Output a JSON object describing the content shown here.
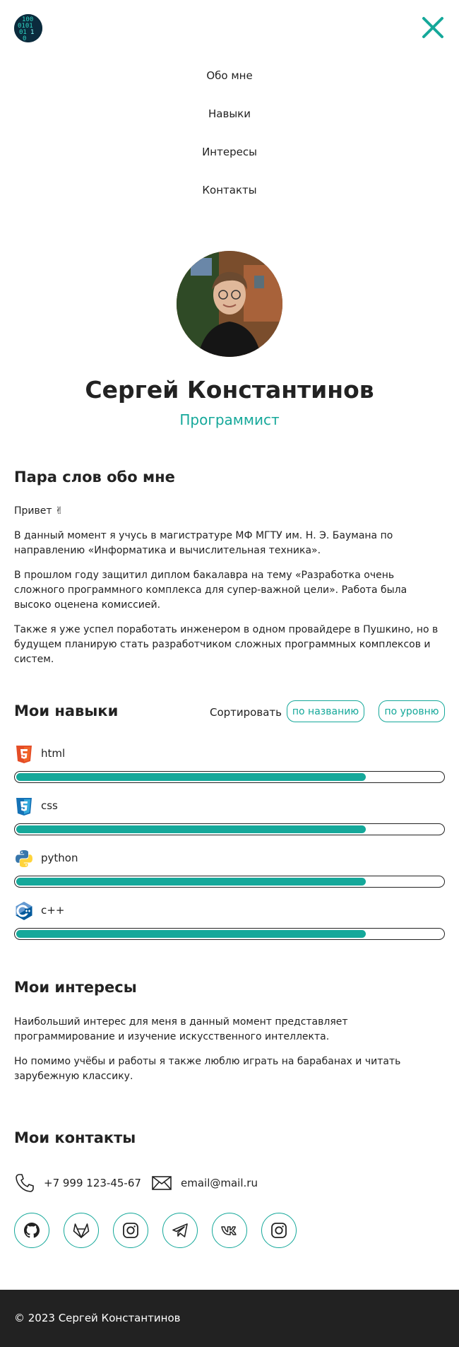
{
  "header": {
    "logo_icon": "binary-code-icon",
    "close_icon": "close-icon",
    "accent": "#15a89a"
  },
  "nav": {
    "items": [
      {
        "label": "Обо мне"
      },
      {
        "label": "Навыки"
      },
      {
        "label": "Интересы"
      },
      {
        "label": "Контакты"
      }
    ]
  },
  "profile": {
    "name": "Сергей Константинов",
    "role": "Программист"
  },
  "about": {
    "title": "Пара слов обо мне",
    "paragraphs": [
      "Привет ✌",
      "В данный момент я учусь в магистратуре МФ МГТУ им. Н. Э. Баумана по направлению «Информатика и вычислительная техника».",
      "В прошлом году защитил диплом бакалавра на тему «Разработка очень сложного программного комплекса для супер-важной цели». Работа была высоко оценена комиссией.",
      "Также я уже успел поработать инженером в одном провайдере в Пушкино, но в будущем планирую стать разработчиком сложных программных комплексов и систем."
    ]
  },
  "skills": {
    "title": "Мои навыки",
    "sort_label": "Сортировать",
    "sort_by_name": "по названию",
    "sort_by_level": "по уровню",
    "items": [
      {
        "label": "html",
        "icon": "html5-icon",
        "level": 0.82
      },
      {
        "label": "css",
        "icon": "css3-icon",
        "level": 0.82
      },
      {
        "label": "python",
        "icon": "python-icon",
        "level": 0.82
      },
      {
        "label": "c++",
        "icon": "cpp-icon",
        "level": 0.82
      }
    ]
  },
  "interests": {
    "title": "Мои интересы",
    "paragraphs": [
      "Наибольший интерес для меня в данный момент представляет программирование и изучение искусственного интеллекта.",
      "Но помимо учёбы и работы я также люблю играть на барабанах и читать зарубежную классику."
    ]
  },
  "contacts": {
    "title": "Мои контакты",
    "phone": "+7 999 123-45-67",
    "email": "email@mail.ru",
    "socials": [
      "github-icon",
      "gitlab-icon",
      "instagram-icon",
      "telegram-icon",
      "vk-icon",
      "instagram-icon"
    ]
  },
  "footer": {
    "copyright": "© 2023 Сергей Константинов"
  }
}
